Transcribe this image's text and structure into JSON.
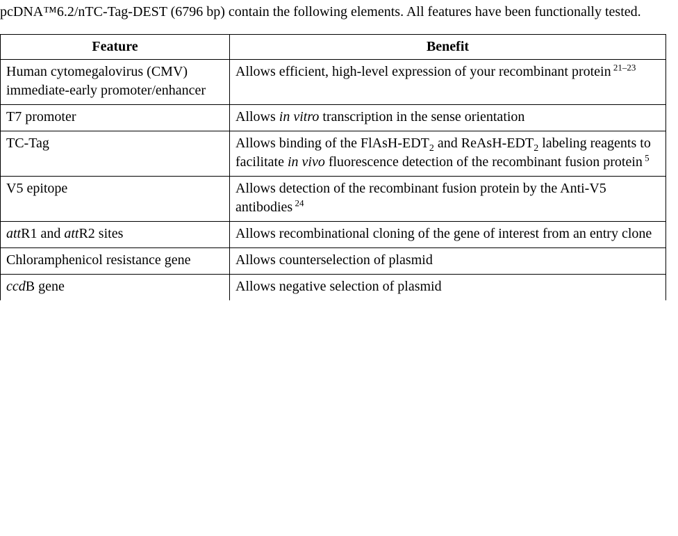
{
  "intro": {
    "line1_pre": "pcDNA",
    "line1_tm": "™",
    "line1_post": "6.2/nTC-Tag-DEST (6796 bp) contain the following elements. All",
    "line2": "features have been functionally tested."
  },
  "table": {
    "headers": {
      "feature": "Feature",
      "benefit": "Benefit"
    },
    "rows": [
      {
        "feature_html": "Human cytomegalovirus (CMV) immediate-early promoter/enhancer",
        "benefit_parts": {
          "text": "Allows efficient, high-level expression of your recombinant protein",
          "sup": "21–23"
        }
      },
      {
        "feature_html": "T7 promoter",
        "benefit_parts": {
          "pre": "Allows ",
          "italic": "in vitro",
          "post": " transcription in the sense orientation"
        }
      },
      {
        "feature_html": "TC-Tag",
        "benefit_parts": {
          "pre": "Allows binding of the FlAsH-EDT",
          "sub1": "2",
          "mid": " and ReAsH-EDT",
          "sub2": "2",
          "post1": " labeling reagents to facilitate ",
          "italic": "in vivo",
          "post2": " fluorescence detection of the recombinant fusion protein",
          "sup": "5"
        }
      },
      {
        "feature_html": "V5 epitope",
        "benefit_parts": {
          "text": "Allows detection of the recombinant fusion protein by the Anti-V5 antibodies",
          "sup": "24"
        }
      },
      {
        "feature_parts": {
          "italic1": "att",
          "mid1": "R1 and ",
          "italic2": "att",
          "mid2": "R2 sites"
        },
        "benefit_parts": {
          "text": "Allows recombinational cloning of the gene of interest from an entry clone"
        }
      },
      {
        "feature_html": "Chloramphenicol resistance gene",
        "benefit_parts": {
          "text": "Allows counterselection of plasmid"
        }
      },
      {
        "feature_parts": {
          "italic1": "ccd",
          "mid1": "B gene"
        },
        "benefit_parts": {
          "text": "Allows negative selection of plasmid"
        }
      }
    ]
  }
}
